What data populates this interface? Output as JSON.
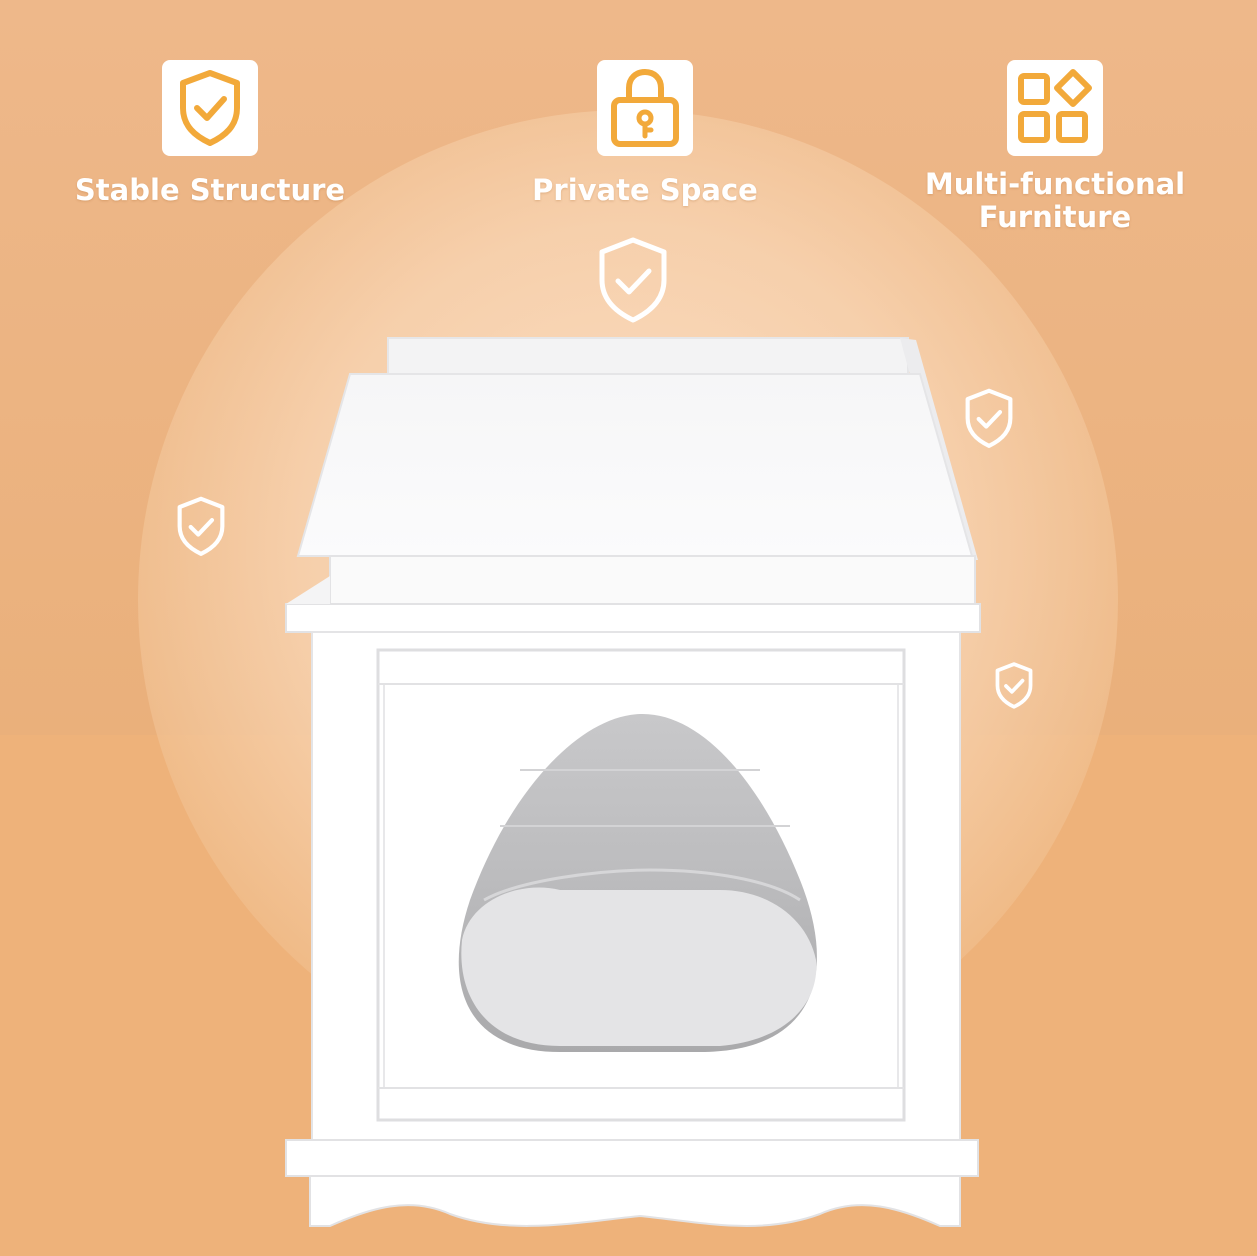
{
  "features": [
    {
      "label": "Stable Structure",
      "icon": "shield-check-icon"
    },
    {
      "label": "Private Space",
      "icon": "padlock-icon"
    },
    {
      "label": "Multi-functional\nFurniture",
      "icon": "grid-shapes-icon"
    }
  ],
  "floating_badges": [
    "shield-check-icon",
    "shield-check-icon",
    "shield-check-icon",
    "shield-check-icon"
  ],
  "colors": {
    "background": "#edb47f",
    "accent": "#f2a93a",
    "label_text": "#ffffff",
    "product": "#ffffff"
  }
}
